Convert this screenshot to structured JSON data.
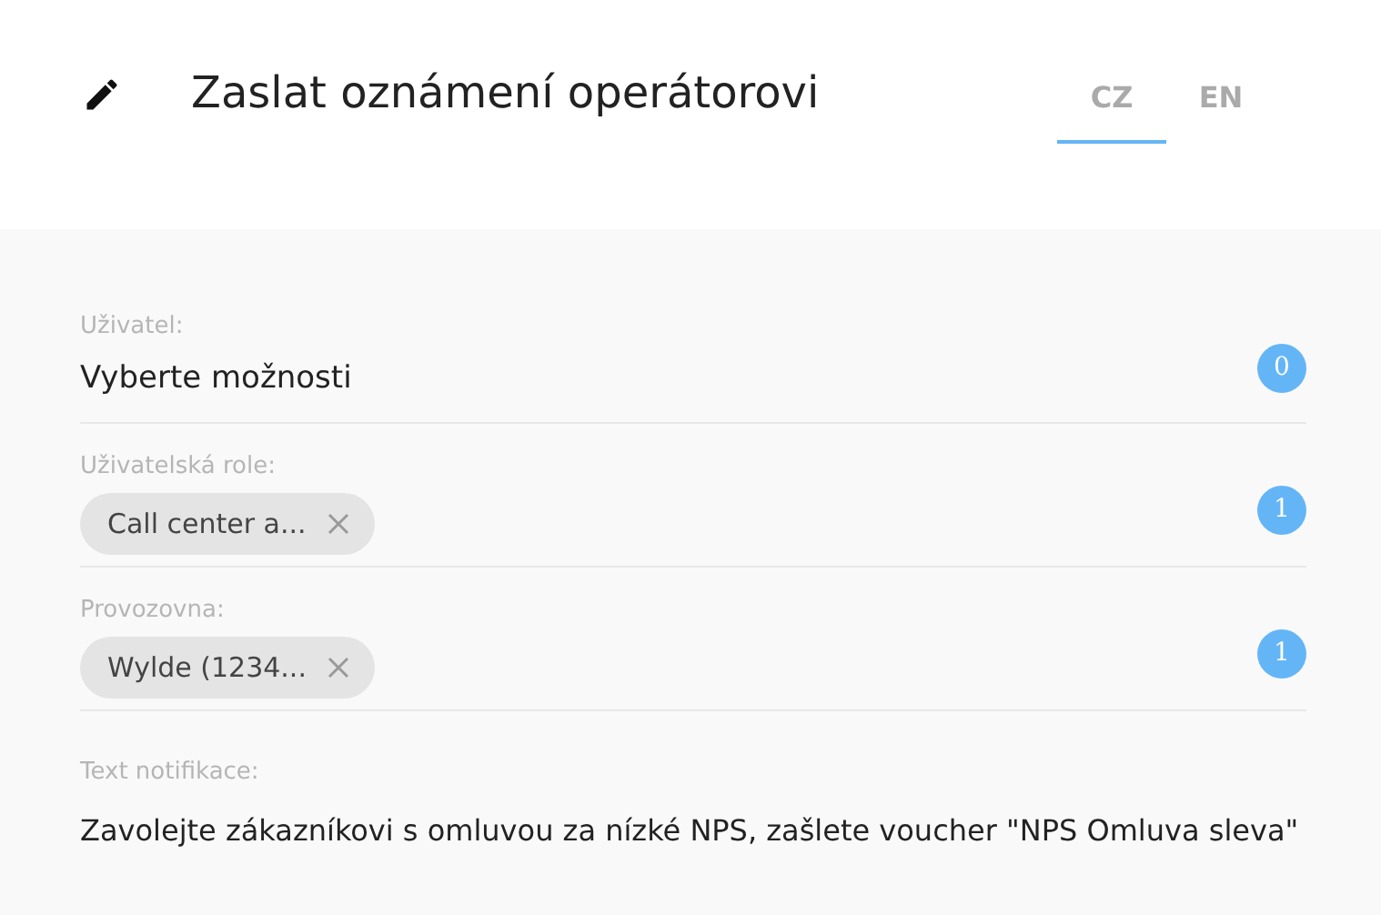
{
  "header": {
    "title": "Zaslat oznámení operátorovi",
    "tabs": [
      {
        "label": "CZ",
        "selected": true
      },
      {
        "label": "EN",
        "selected": false
      }
    ]
  },
  "fields": [
    {
      "kind": "select",
      "label": "Uživatel:",
      "placeholder": "Vyberte možnosti",
      "count": "0"
    },
    {
      "kind": "chips",
      "label": "Uživatelská role:",
      "chips": [
        "Call center a..."
      ],
      "count": "1"
    },
    {
      "kind": "chips",
      "label": "Provozovna:",
      "chips": [
        "Wylde (1234..."
      ],
      "count": "1"
    },
    {
      "kind": "text",
      "label": "Text notifikace:",
      "value": "Zavolejte zákazníkovi s omluvou za nízké NPS, zašlete voucher \"NPS Omluva sleva\""
    }
  ]
}
